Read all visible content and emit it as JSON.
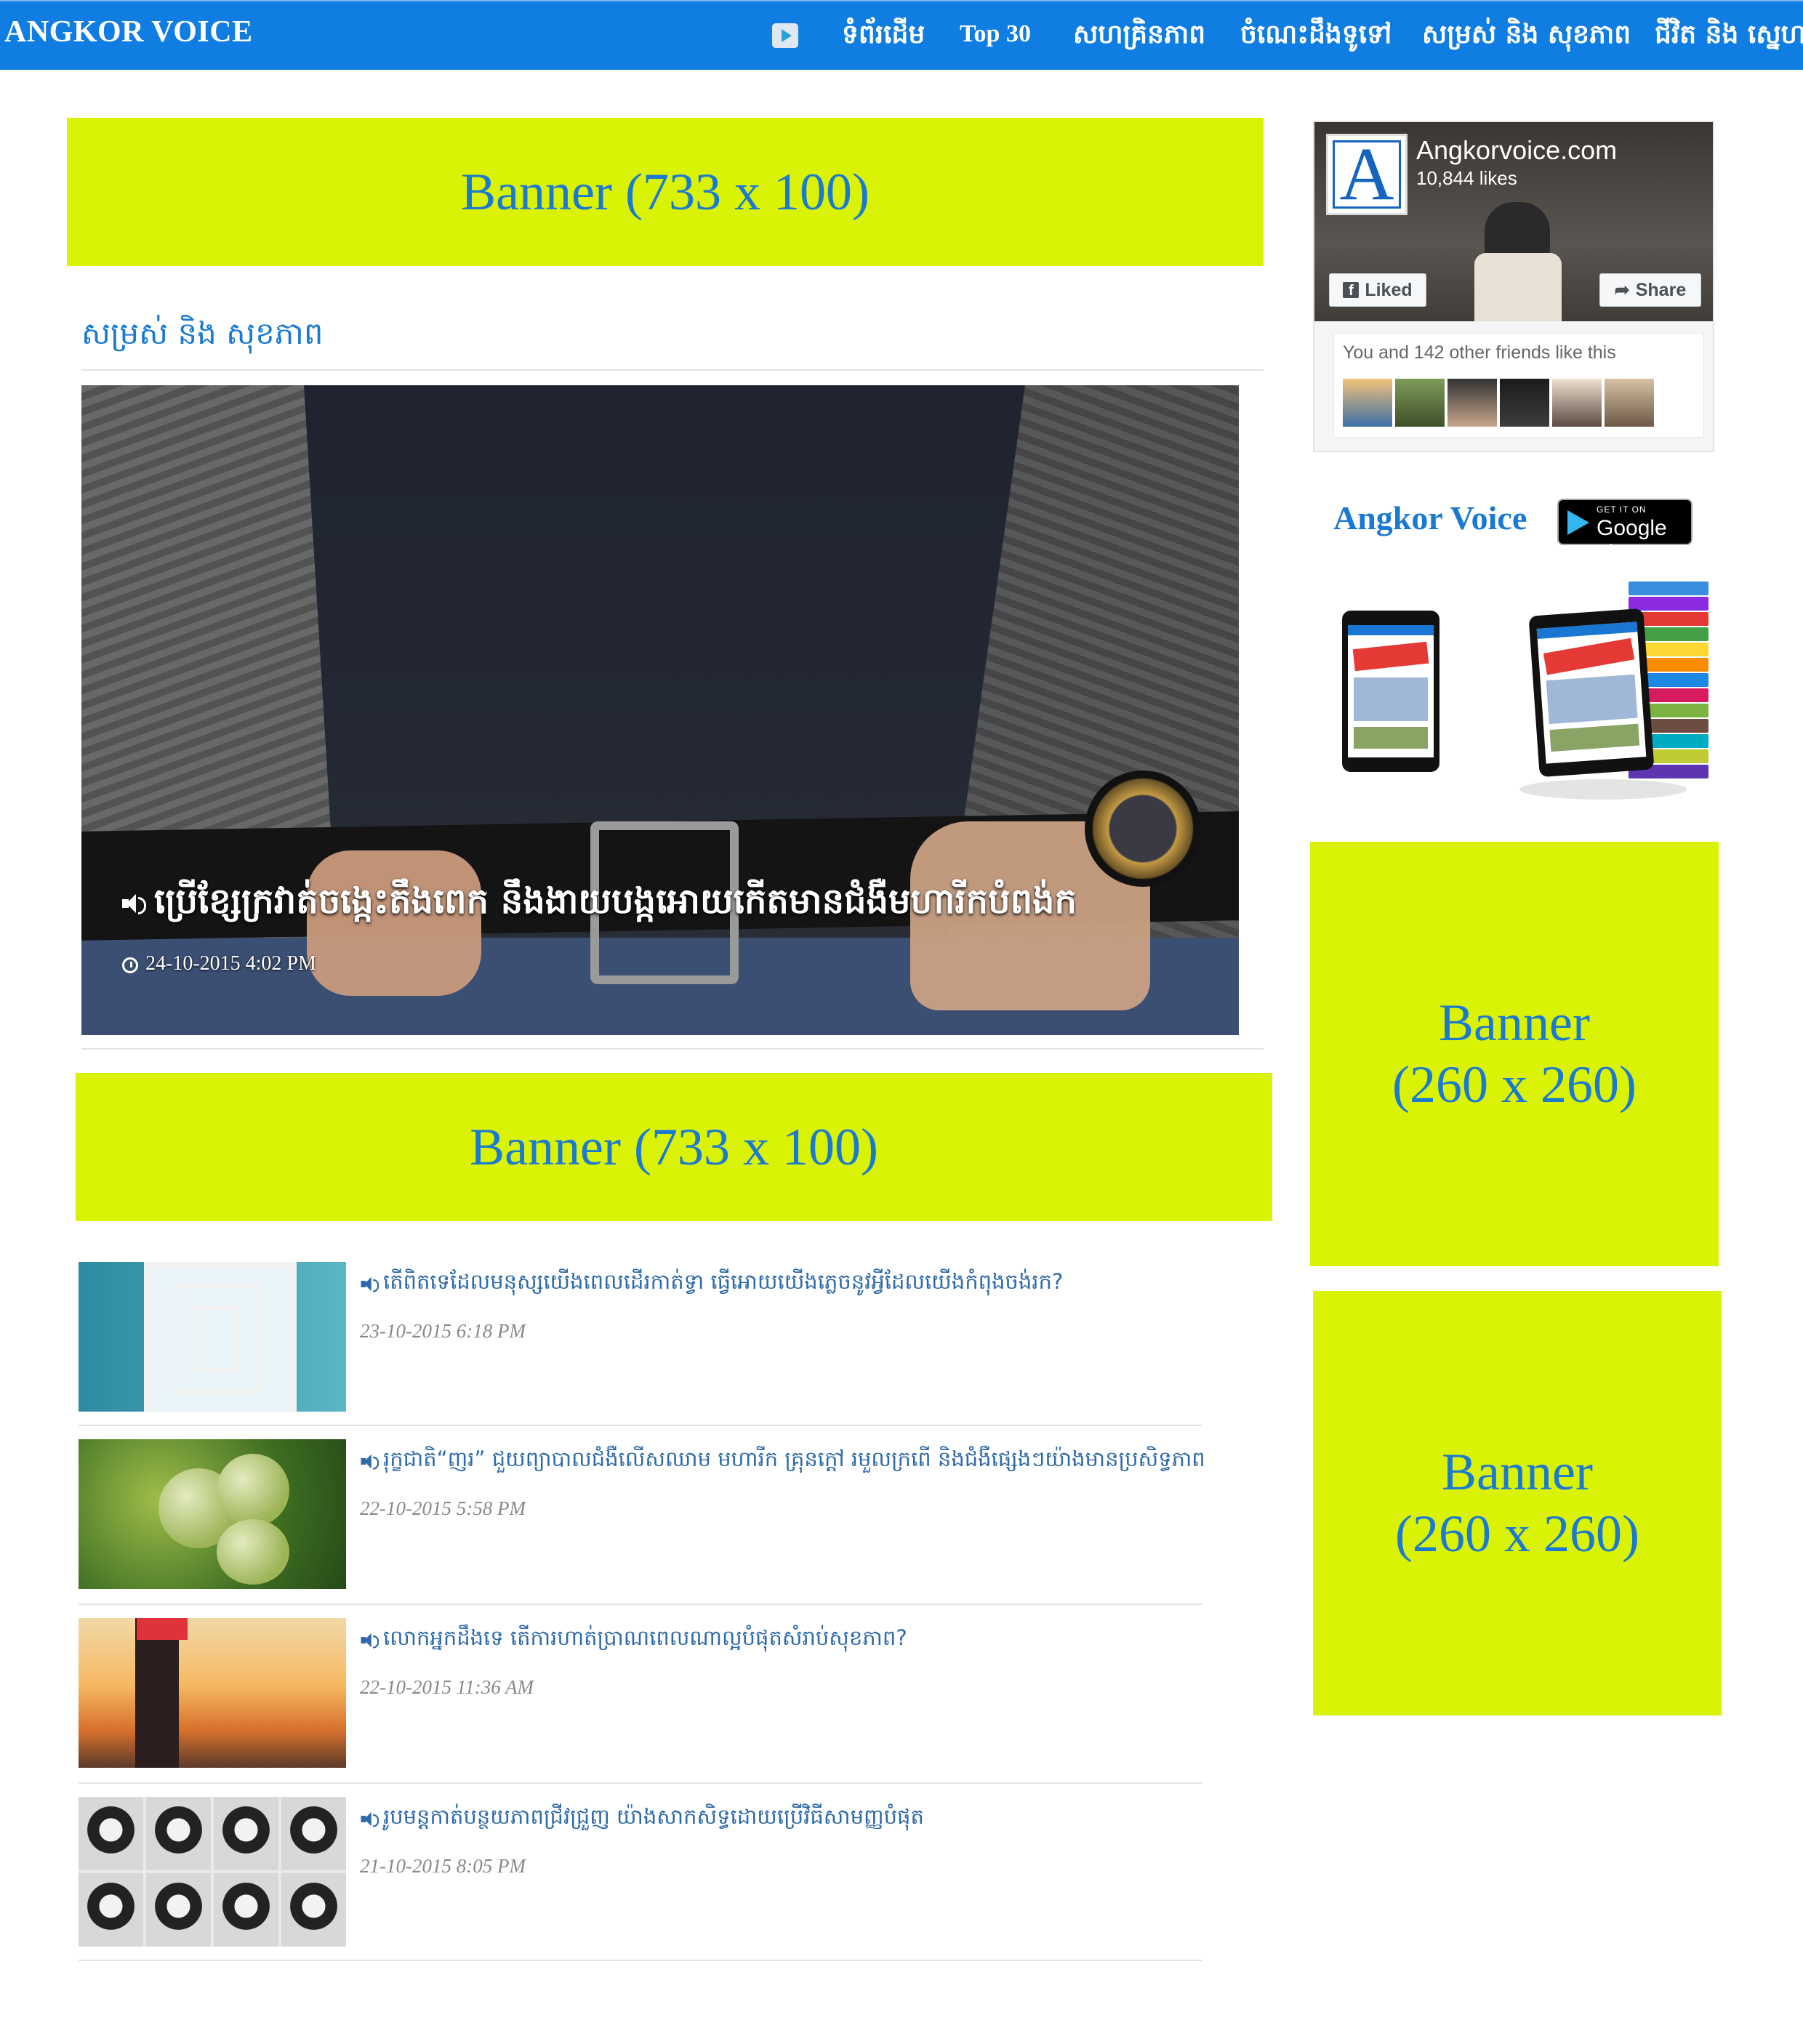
{
  "nav": {
    "brand": "ANGKOR VOICE",
    "items": [
      "ទំព័រដើម",
      "Top 30",
      "សហគ្រិនភាព",
      "ចំណេះដឹងទូទៅ",
      "សម្រស់ និង សុខភាព",
      "ជីវិត និង ស្នេហា"
    ]
  },
  "banners": {
    "top": "Banner (733 x 100)",
    "middle": "Banner (733 x 100)",
    "side1": [
      "Banner",
      "(260 x 260)"
    ],
    "side2": [
      "Banner",
      "(260 x 260)"
    ]
  },
  "section": {
    "title": "សម្រស់ និង សុខភាព"
  },
  "featured": {
    "title": "ប្រើខ្សែក្រវាត់ចង្កេះតឹងពេក នឹងងាយបង្កអោយកើតមានជំងឺមហារីកបំពង់ក",
    "date": "24-10-2015 4:02 PM"
  },
  "articles": [
    {
      "title": "តើពិតទេដែលមនុស្សយើងពេលដើរកាត់ទ្វា ធ្វើអោយយើងភ្លេចនូវអ្វីដែលយើងកំពុងចង់រក?",
      "date": "23-10-2015 6:18 PM",
      "thumb": "doors-image"
    },
    {
      "title": "រុក្ខជាតិ“ញរ” ជួយព្យាបាលជំងឺលើសឈាម មហារីក គ្រុនក្តៅ រមួលក្រពើ និងជំងឺផ្សេងៗយ៉ាងមានប្រសិទ្ធភាព",
      "date": "22-10-2015 5:58 PM",
      "thumb": "noni-fruit-image"
    },
    {
      "title": "លោកអ្នកដឹងទេ តើការហាត់ប្រាណពេលណាល្អបំផុតសំរាប់សុខភាព?",
      "date": "22-10-2015 11:36 AM",
      "thumb": "runner-sunset-image"
    },
    {
      "title": "រូបមន្តកាត់បន្ថយភាពជ្រីវជ្រួញ យ៉ាងសាកសិទ្ធដោយប្រើវិធីសាមញ្ញបំផុត",
      "date": "21-10-2015 8:05 PM",
      "thumb": "faces-grid-image"
    }
  ],
  "facebook": {
    "page_name": "Angkorvoice.com",
    "likes": "10,844 likes",
    "liked_label": "Liked",
    "share_label": "Share",
    "friends_text": "You and 142 other friends like this",
    "logo_letter": "A"
  },
  "app": {
    "title": "Angkor Voice",
    "badge_small": "GET IT ON",
    "badge_big": "Google play"
  },
  "colors": {
    "nav_bg": "#0f7de2",
    "banner_bg": "#d9f205",
    "banner_text": "#1a7ad1",
    "link": "#2f6aa8"
  }
}
